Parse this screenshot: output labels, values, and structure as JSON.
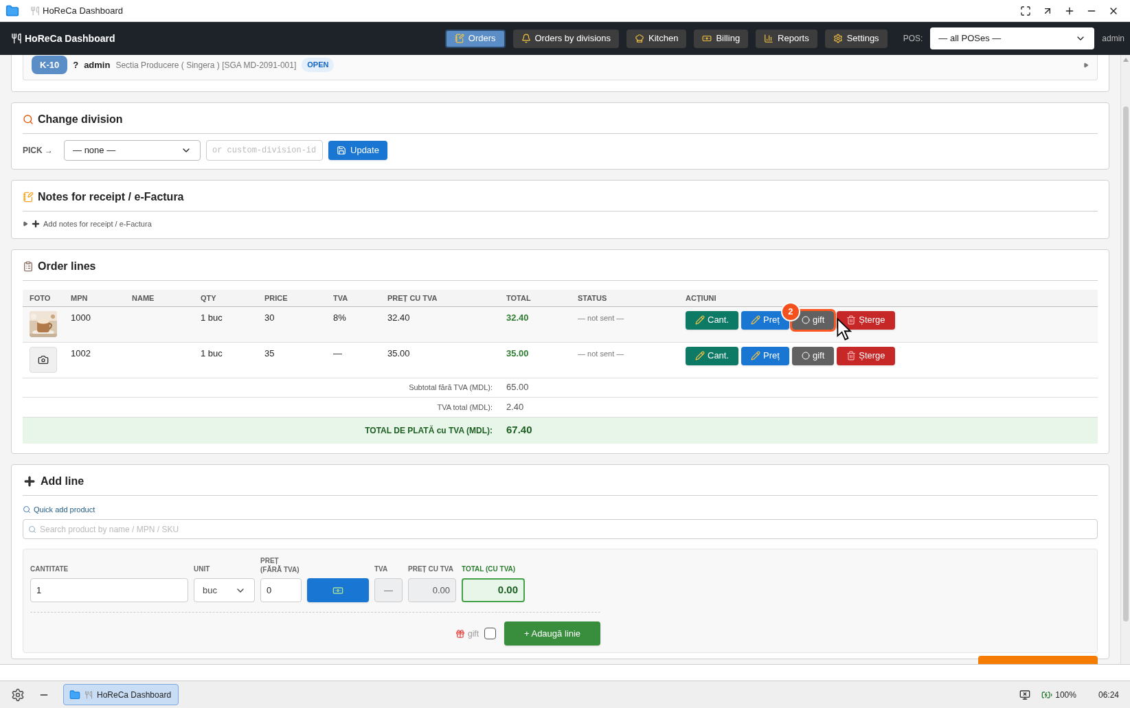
{
  "window": {
    "title": "HoReCa Dashboard"
  },
  "navbar": {
    "brand": "HoReCa Dashboard",
    "items": [
      {
        "label": "Orders",
        "selected": true
      },
      {
        "label": "Orders by divisions",
        "selected": false
      },
      {
        "label": "Kitchen",
        "selected": false
      },
      {
        "label": "Billing",
        "selected": false
      },
      {
        "label": "Reports",
        "selected": false
      },
      {
        "label": "Settings",
        "selected": false
      }
    ],
    "pos_label": "POS:",
    "pos_value": "— all POSes —",
    "user": "admin"
  },
  "order_header": {
    "code": "K-10",
    "table": "?",
    "user": "admin",
    "division": "Sectia Producere ( Singera ) [SGA MD-2091-001]",
    "status": "OPEN"
  },
  "change_division": {
    "title": "Change division",
    "pick_label": "PICK →",
    "select_value": "— none —",
    "custom_placeholder": "or custom-division-id",
    "button": "Update"
  },
  "notes": {
    "title": "Notes for receipt / e-Factura",
    "summary": "Add notes for receipt / e-Factura",
    "expanded": false
  },
  "order_lines": {
    "title": "Order lines",
    "columns": [
      "FOTO",
      "MPN",
      "NAME",
      "QTY",
      "PRICE",
      "TVA",
      "PREȚ CU TVA",
      "TOTAL",
      "STATUS",
      "ACȚIUNI"
    ],
    "rows": [
      {
        "mpn": "1000",
        "qty": "1 buc",
        "price": "30",
        "tva": "8%",
        "pret_cu_tva": "32.40",
        "total": "32.40",
        "status": "— not sent —",
        "actions": [
          {
            "kind": "qty",
            "label": "Cant.",
            "highlighted": false
          },
          {
            "kind": "price",
            "label": "Preț",
            "highlighted": false
          },
          {
            "kind": "gift",
            "label": "gift",
            "highlighted": true,
            "badge": "2"
          },
          {
            "kind": "delete",
            "label": "Șterge",
            "highlighted": false
          }
        ]
      },
      {
        "photo": {
          "kind": "placeholder"
        },
        "mpn": "1002",
        "qty": "1 buc",
        "price": "35",
        "tva": "—",
        "pret_cu_tva": "35.00",
        "total": "35.00",
        "status": "— not sent —",
        "actions": [
          {
            "kind": "qty",
            "label": "Cant.",
            "highlighted": false
          },
          {
            "kind": "price",
            "label": "Preț",
            "highlighted": false
          },
          {
            "kind": "gift",
            "label": "gift",
            "highlighted": false
          },
          {
            "kind": "delete",
            "label": "Șterge",
            "highlighted": false
          }
        ]
      }
    ],
    "subtotal_label": "Subtotal fără TVA (MDL):",
    "subtotal": "65.00",
    "tva_label": "TVA total (MDL):",
    "tva_total": "2.40",
    "total_label": "TOTAL DE PLATĂ cu TVA (MDL):",
    "total": "67.40"
  },
  "add_line": {
    "title": "Add line",
    "quick_add_label": "Quick add product",
    "search_placeholder": "Search product by name / MPN / SKU",
    "qty_label": "CANTITATE",
    "qty_value": "1",
    "unit_label": "UNIT",
    "unit_value": "buc",
    "price_label": "PREȚ (FĂRĂ TVA)",
    "price_value": "0",
    "tva_label": "TVA",
    "tva_value": "—",
    "pret_cu_tva_label": "PREȚ CU TVA",
    "pret_cu_tva_value": "0.00",
    "total_label": "TOTAL (CU TVA)",
    "total_value": "0.00",
    "gift_label": "gift",
    "gift_checked": false,
    "add_button": "+ Adaugă linie"
  },
  "taskbar": {
    "task": {
      "label": "HoReCa Dashboard",
      "selected": true
    },
    "battery": "100%",
    "clock": "06:24"
  }
}
